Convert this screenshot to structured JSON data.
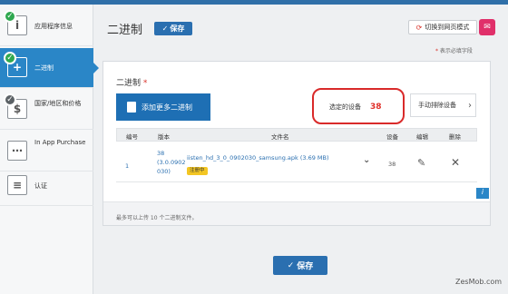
{
  "header": {
    "title": "二进制",
    "save_label": "保存",
    "mode_switch_label": "切换到网页模式",
    "required_note": "表示必填字段"
  },
  "sidebar": {
    "items": [
      {
        "label": "应用程序信息",
        "icon": "info-icon",
        "status": "complete"
      },
      {
        "label": "二进制",
        "icon": "binary-icon",
        "status": "complete",
        "active": true
      },
      {
        "label": "国家/地区和价格",
        "icon": "dollar-icon",
        "status": "incomplete"
      },
      {
        "label": "In App Purchase",
        "icon": "purchase-icon",
        "status": "none"
      },
      {
        "label": "认证",
        "icon": "certificate-icon",
        "status": "none"
      }
    ]
  },
  "binary_section": {
    "title": "二进制",
    "add_button_label": "添加更多二进制",
    "selected_devices_label": "选定的设备",
    "selected_devices_count": "38",
    "manual_exclude_label": "手动排除设备",
    "table": {
      "columns": [
        "编号",
        "版本",
        "文件名",
        "设备",
        "编辑",
        "删除"
      ],
      "rows": [
        {
          "number": "1",
          "version_line1": "38",
          "version_line2": "(3.0.0902",
          "version_line3": "030)",
          "filename": "iisten_hd_3_0_0902030_samsung.apk (3.69 MB)",
          "status": "注册中",
          "devices": "38"
        }
      ]
    },
    "footer_note": "最多可以上传 10 个二进制文件。"
  },
  "footer": {
    "save_label": "保存"
  },
  "watermark": "ZesMob.com",
  "colors": {
    "primary": "#2a6fb0",
    "active_sidebar": "#2a86c7",
    "highlight_red": "#d92a2a",
    "status_yellow": "#f3c623"
  }
}
